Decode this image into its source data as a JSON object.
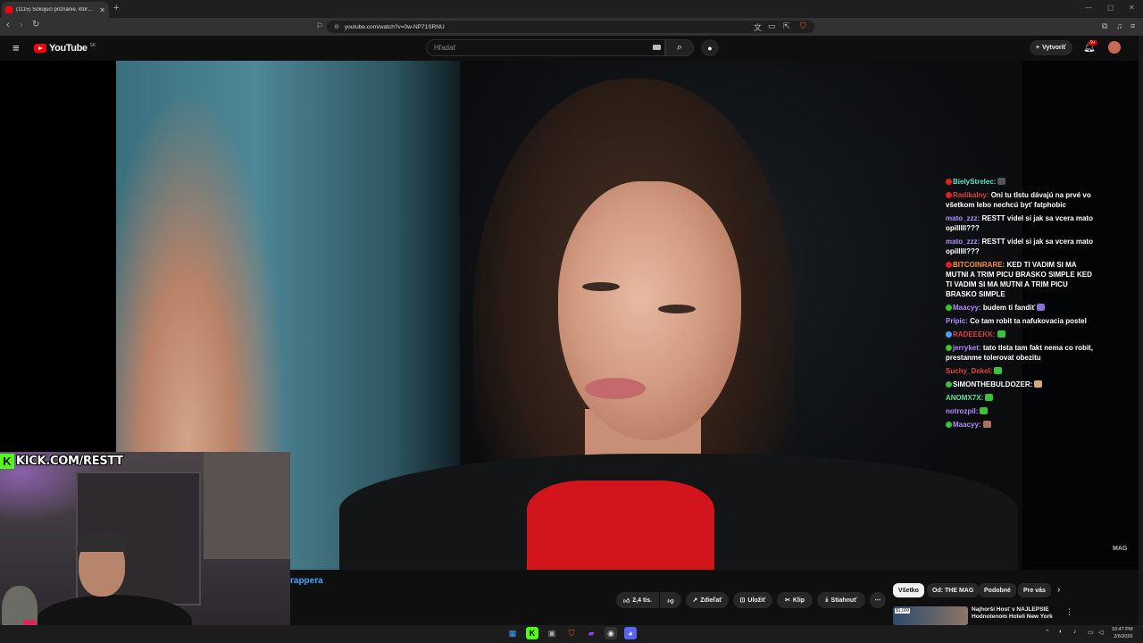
{
  "browser": {
    "tab_title": "(1115) Šokujúci priznanie, ktoré…",
    "url": "youtube.com/watch?v=0w-NP71SRNU"
  },
  "youtube": {
    "logo_text": "YouTube",
    "country_code": "SK",
    "search_placeholder": "Hľadať",
    "create_label": "Vytvoriť",
    "notif_count": "9+"
  },
  "overlay": {
    "kick_text": "KICK.COM/RESTT",
    "watermark": "MAG"
  },
  "chat": {
    "messages": [
      {
        "user": "BielyStrelec:",
        "user_color": "#5fe0c8",
        "text": "",
        "badge": "#e02020",
        "emote": "dark"
      },
      {
        "user": "Radikalny:",
        "user_color": "#e04040",
        "text": "Oni tu tlstu dávajú na prvé vo všetkom lebo nechcú byť fatphobic",
        "badge": "#e02020",
        "emote": ""
      },
      {
        "user": "mato_zzz:",
        "user_color": "#b48cff",
        "text": "RESTT videl si jak sa vcera mato opilllll???",
        "badge": "",
        "emote": ""
      },
      {
        "user": "mato_zzz:",
        "user_color": "#b48cff",
        "text": "RESTT videl si jak sa vcera mato opilllll???",
        "badge": "",
        "emote": ""
      },
      {
        "user": "BITCOINRARE:",
        "user_color": "#ff8c3c",
        "text": "KED TI VADIM SI MA MUTNI A TRIM PICU BRASKO SIMPLE KED TI VADIM SI MA MUTNI A TRIM PICU BRASKO SIMPLE",
        "badge": "#e02020",
        "emote": ""
      },
      {
        "user": "Maacyy:",
        "user_color": "#b48cff",
        "text": "budem ti fandiť",
        "badge": "#39c23a",
        "emote": "purple"
      },
      {
        "user": "Pripic:",
        "user_color": "#b48cff",
        "text": "Co tam robit ta nafukovacia postel",
        "badge": "",
        "emote": ""
      },
      {
        "user": "RADEEEKK:",
        "user_color": "#e04040",
        "text": "",
        "badge": "#3ea6ff",
        "emote": "green"
      },
      {
        "user": "jerryket:",
        "user_color": "#b48cff",
        "text": "tato tlsta tam fakt nema co robit, prestanme tolerovat obezitu",
        "badge": "#39c23a",
        "emote": ""
      },
      {
        "user": "Suchy_Dekel:",
        "user_color": "#e04040",
        "text": "",
        "badge": "",
        "emote": "green"
      },
      {
        "user": "SIMONTHEBULDOZER:",
        "user_color": "#ffffff",
        "text": "",
        "badge": "#39c23a",
        "emote": "hand"
      },
      {
        "user": "ANOMX7X:",
        "user_color": "#5fe0a0",
        "text": "",
        "badge": "",
        "emote": "green"
      },
      {
        "user": "notrozpil:",
        "user_color": "#b48cff",
        "text": "",
        "badge": "",
        "emote": "green"
      },
      {
        "user": "Maacyy:",
        "user_color": "#b48cff",
        "text": "",
        "badge": "#39c23a",
        "emote": "brown"
      }
    ]
  },
  "video_meta": {
    "title_fragment": "rappera",
    "likes": "2,4 tis.",
    "share_label": "Zdieľať",
    "save_label": "Uložiť",
    "clip_label": "Klip",
    "download_label": "Stiahnuť"
  },
  "chips": [
    "Všetko",
    "Od: THE MAG",
    "Podobné",
    "Pre vás"
  ],
  "recommendation": {
    "badge": "$1,000",
    "title": "Najhorší Hosť v NAJLEPŠIE Hodnotenom Hoteli New York"
  },
  "tray": {
    "time": "10:47 PM",
    "date": "2/6/2026"
  }
}
